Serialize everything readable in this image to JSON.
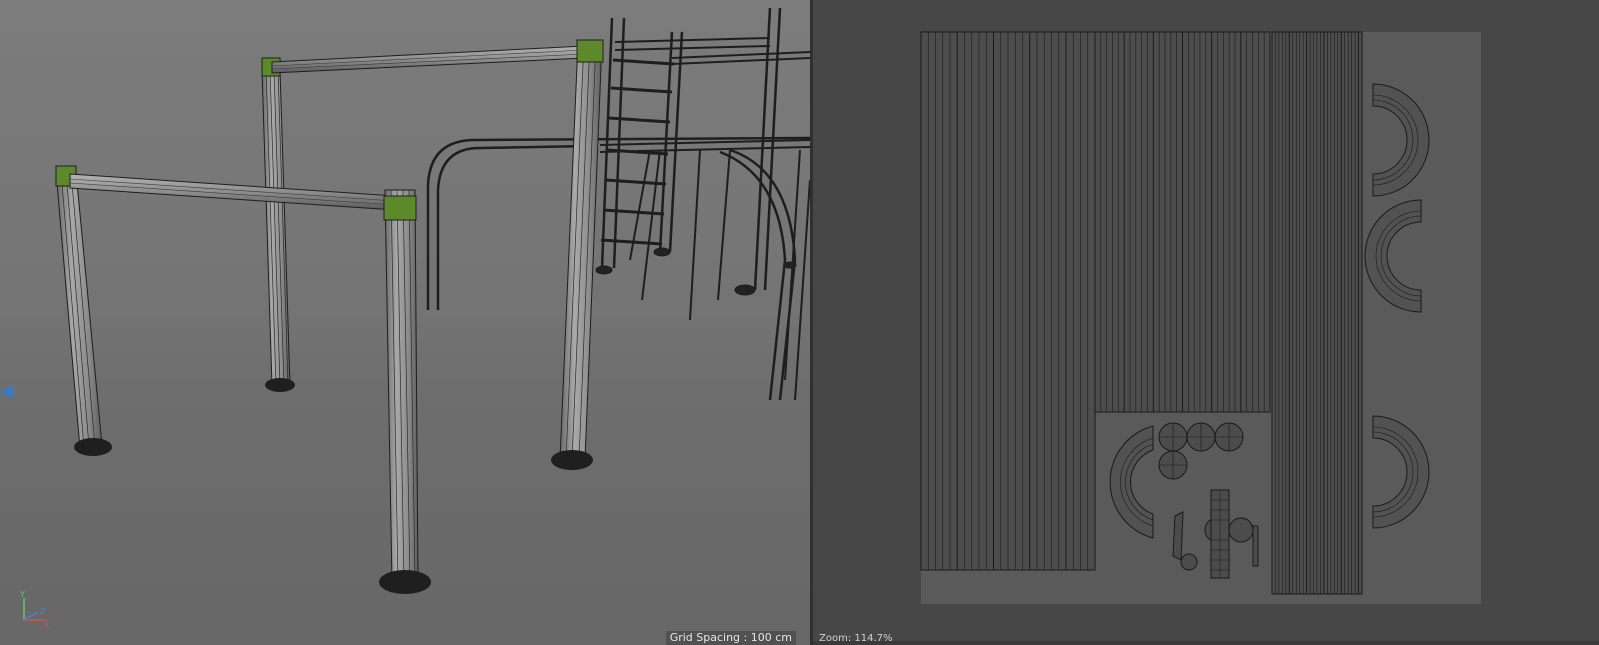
{
  "viewport": {
    "grid_spacing": "Grid Spacing : 100 cm",
    "axis": {
      "y": "Y",
      "z": "Z",
      "x": "X"
    }
  },
  "uv_editor": {
    "zoom": "Zoom: 114.7%"
  },
  "colors": {
    "viewport_bg": "#747474",
    "wire": "#1e1e1e",
    "selection_green": "#5c8a2a",
    "uv_bg": "#474747",
    "uv_texture": "#5a5a5a",
    "uv_lines": "#1a1a1a"
  }
}
